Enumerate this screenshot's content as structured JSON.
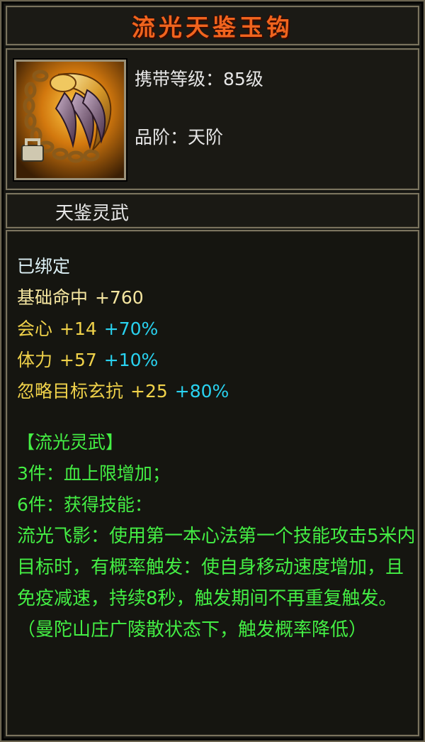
{
  "item": {
    "name": "流光天鉴玉钩",
    "level_text": "携带等级：85级",
    "grade_text": "品阶：天阶",
    "category": "天鉴灵武",
    "bound": "已绑定"
  },
  "stats": [
    {
      "name": "基础命中",
      "value": "+760",
      "bonus": ""
    },
    {
      "name": "会心",
      "value": "+14",
      "bonus": "+70%"
    },
    {
      "name": "体力",
      "value": "+57",
      "bonus": "+10%"
    },
    {
      "name": "忽略目标玄抗",
      "value": "+25",
      "bonus": "+80%"
    }
  ],
  "set": {
    "title": "【流光灵武】",
    "piece3": "3件：血上限增加；",
    "piece6": "6件：获得技能：",
    "skill_desc": "流光飞影：使用第一本心法第一个技能攻击5米内目标时，有概率触发：使自身移动速度增加，且免疫减速，持续8秒，触发期间不再重复触发。（曼陀山庄广陵散状态下，触发概率降低）"
  },
  "colors": {
    "title": "#f0641e",
    "stat_name": "#f0d24a",
    "bonus": "#29d2f0",
    "set_text": "#44ee44"
  },
  "icons": {
    "item_icon": "golden-hook-icon",
    "bound_marker": "lock-icon"
  }
}
